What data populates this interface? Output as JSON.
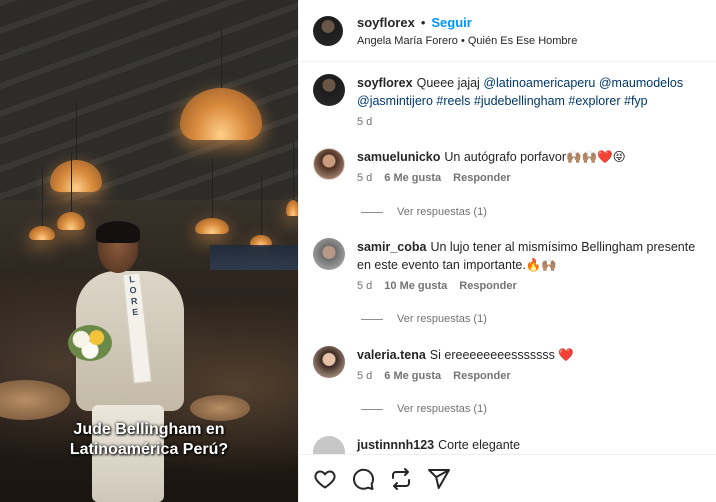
{
  "post": {
    "caption_overlay_line1": "Jude Bellingham en",
    "caption_overlay_line2": "Latinoamérica Perú?",
    "sash_letters": [
      "L",
      "O",
      "R",
      "E"
    ]
  },
  "header": {
    "username": "soyflorex",
    "separator": "•",
    "follow_label": "Seguir",
    "audio_artist": "Angela María Forero",
    "audio_separator": "•",
    "audio_title": "Quién Es Ese Hombre"
  },
  "caption": {
    "username": "soyflorex",
    "text": "Queee jajaj",
    "mentions": "@latinoamericaperu @maumodelos @jasmintijero #reels #judebellingham #explorer #fyp",
    "time": "5 d"
  },
  "comments": [
    {
      "username": "samuelunicko",
      "text": "Un autógrafo porfavor🙌🏽🙌🏽❤️😝",
      "time": "5 d",
      "likes": "6 Me gusta",
      "reply_label": "Responder",
      "view_replies": "Ver respuestas (1)"
    },
    {
      "username": "samir_coba",
      "text": "Un lujo tener al mismísimo Bellingham presente en este evento tan importante.🔥🙌🏽",
      "time": "5 d",
      "likes": "10 Me gusta",
      "reply_label": "Responder",
      "view_replies": "Ver respuestas (1)"
    },
    {
      "username": "valeria.tena",
      "text": "Si ereeeeeeeesssssss ❤️",
      "time": "5 d",
      "likes": "6 Me gusta",
      "reply_label": "Responder",
      "view_replies": "Ver respuestas (1)"
    },
    {
      "username": "justinnnh123",
      "text": "Corte elegante"
    }
  ],
  "actions": {
    "icons": [
      "heart-icon",
      "comment-icon",
      "repost-icon",
      "share-icon"
    ]
  },
  "colors": {
    "link": "#00376b",
    "follow": "#0095f6",
    "meta": "#737373",
    "heart": "#ed4956"
  }
}
